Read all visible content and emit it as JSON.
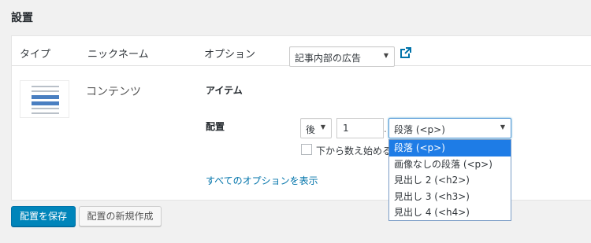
{
  "section": {
    "title": "設置"
  },
  "table": {
    "headers": {
      "type": "タイプ",
      "nickname": "ニックネーム",
      "options": "オプション"
    }
  },
  "row": {
    "nickname": "コンテンツ",
    "item_label": "アイテム",
    "item_value": "記事内部の広告",
    "placement_label": "配置",
    "position_value": "後",
    "number_value": "1",
    "paragraph_value": "段落 (<p>)",
    "checkbox_label": "下から数え始める",
    "checkbox_checked": false,
    "show_all_options": "すべてのオプションを表示"
  },
  "dropdown": {
    "options": [
      "段落 (<p>)",
      "画像なしの段落 (<p>)",
      "見出し 2 (<h2>)",
      "見出し 3 (<h3>)",
      "見出し 4 (<h4>)"
    ],
    "selected_index": 0
  },
  "buttons": {
    "save": "配置を保存",
    "new": "配置の新規作成"
  },
  "colors": {
    "primary": "#0085ba",
    "link": "#0073aa",
    "highlight": "#1e7ce6"
  }
}
